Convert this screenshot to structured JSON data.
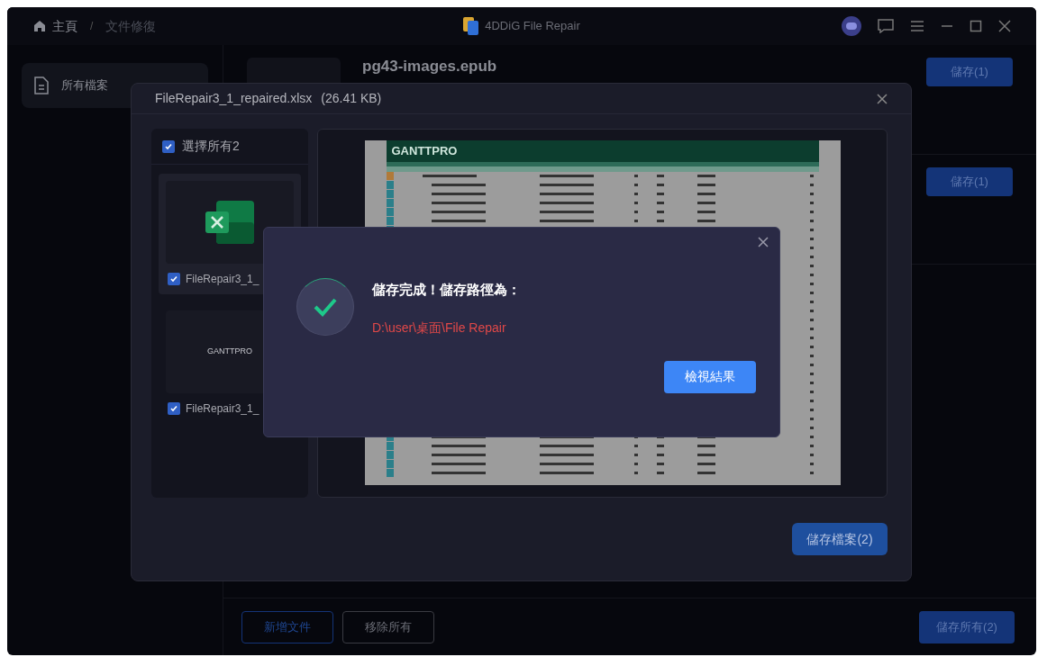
{
  "titlebar": {
    "breadcrumbs": [
      {
        "label": "主頁",
        "selected": false
      },
      {
        "label": "文件修復",
        "selected": true
      }
    ],
    "separator": "/",
    "app_title": "4DDiG File Repair"
  },
  "sidebar": {
    "items": [
      {
        "label": "所有檔案",
        "selected": true
      }
    ]
  },
  "file_list": [
    {
      "name": "pg43-images.epub",
      "button": "儲存(1)"
    },
    {
      "button": "儲存(1)"
    }
  ],
  "footer": {
    "add_button": "新增文件",
    "remove_button": "移除所有",
    "save_all_button": "儲存所有(2)"
  },
  "preview_dialog": {
    "title": "FileRepair3_1_repaired.xlsx",
    "size": "(26.41 KB)",
    "select_all": {
      "label": "選擇所有2",
      "checked": true
    },
    "files": [
      {
        "kind": "excel",
        "name": "FileRepair3_1_",
        "checked": true,
        "selected": true
      },
      {
        "kind": "gantt",
        "thumb_text": "GANTTPRO",
        "name": "FileRepair3_1_",
        "checked": true,
        "selected": false
      }
    ],
    "preview_logo": "GANTTPRO",
    "save_button": "儲存檔案(2)"
  },
  "success_dialog": {
    "heading": "儲存完成！儲存路徑為：",
    "path": "D:\\user\\桌面\\File Repair",
    "button": "檢視結果"
  }
}
